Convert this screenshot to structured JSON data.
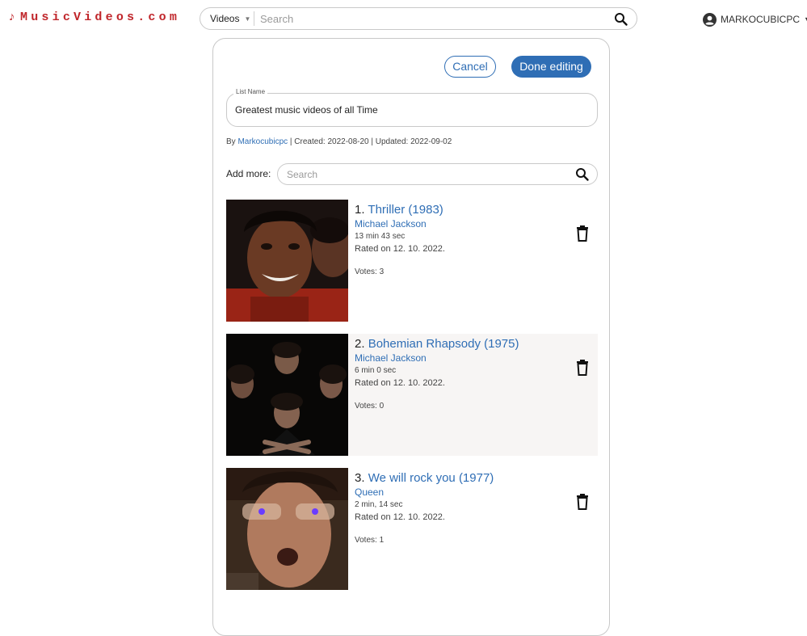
{
  "header": {
    "logo": "MusicVideos.com",
    "search": {
      "category": "Videos",
      "placeholder": "Search"
    },
    "user": "MARKOCUBICPC"
  },
  "editor": {
    "cancel_label": "Cancel",
    "done_label": "Done editing",
    "list_name_label": "List Name",
    "list_name_value": "Greatest music videos of all Time",
    "meta": {
      "by_prefix": "By ",
      "author": "Markocubicpc",
      "created": " | Created: 2022-08-20 | Updated: 2022-09-02"
    },
    "add_more_label": "Add more:",
    "add_more_placeholder": "Search"
  },
  "items": [
    {
      "rank": "1.",
      "title": "Thriller (1983)",
      "artist": "Michael Jackson",
      "duration": "13 min 43 sec",
      "rated": "Rated on 12. 10. 2022.",
      "votes": "Votes: 3"
    },
    {
      "rank": "2.",
      "title": "Bohemian Rhapsody (1975)",
      "artist": "Michael Jackson",
      "duration": "6 min 0 sec",
      "rated": "Rated on 12. 10. 2022.",
      "votes": "Votes: 0"
    },
    {
      "rank": "3.",
      "title": "We will rock you (1977)",
      "artist": "Queen",
      "duration": "2 min, 14 sec",
      "rated": "Rated on 12. 10. 2022.",
      "votes": "Votes: 1"
    }
  ],
  "colors": {
    "brand": "#c0262b",
    "accent": "#2f6eb5",
    "alt_row": "#f7f5f4"
  },
  "icons": [
    "music-note-icon",
    "chevron-down-icon",
    "search-icon",
    "account-circle-icon",
    "trash-icon"
  ]
}
